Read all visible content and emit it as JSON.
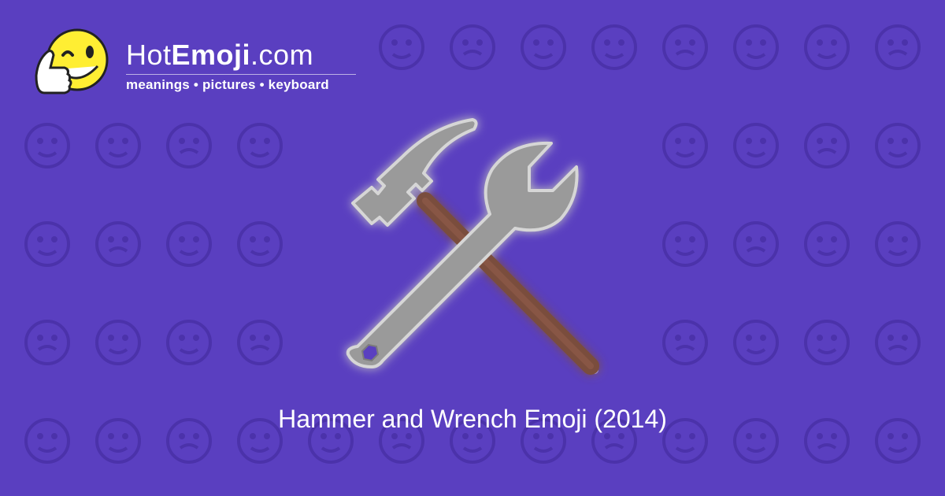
{
  "site": {
    "name_prefix": "Hot",
    "name_bold": "Emoji",
    "name_suffix": ".com",
    "tagline": "meanings • pictures • keyboard"
  },
  "emoji": {
    "caption": "Hammer and Wrench Emoji (2014)",
    "icon": "hammer-and-wrench-icon"
  },
  "colors": {
    "background": "#5a3fc0",
    "pattern": "#4d34ad",
    "hammer_head": "#9a9a9a",
    "handle": "#7a4d3c",
    "logo_yellow": "#ffee33"
  }
}
